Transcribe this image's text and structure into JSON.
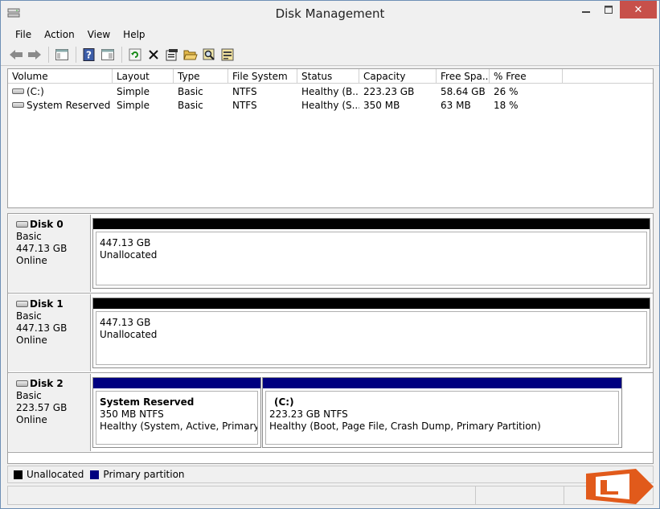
{
  "window": {
    "title": "Disk Management",
    "close_glyph": "✕",
    "minimize_glyph": "—",
    "maximize_glyph": "☐"
  },
  "menu": {
    "items": [
      {
        "label": "File"
      },
      {
        "label": "Action"
      },
      {
        "label": "View"
      },
      {
        "label": "Help"
      }
    ]
  },
  "toolbar": {
    "icons": [
      "back-arrow-icon",
      "forward-arrow-icon",
      "console-tree-icon",
      "help-icon",
      "properties-pane-icon",
      "refresh-icon",
      "delete-icon",
      "properties-icon",
      "open-icon",
      "search-icon",
      "disk-settings-icon"
    ]
  },
  "volume_list": {
    "columns": [
      "Volume",
      "Layout",
      "Type",
      "File System",
      "Status",
      "Capacity",
      "Free Spa...",
      "% Free"
    ],
    "rows": [
      {
        "volume": "(C:)",
        "layout": "Simple",
        "type": "Basic",
        "fs": "NTFS",
        "status": "Healthy (B...",
        "capacity": "223.23 GB",
        "free": "58.64 GB",
        "pct": "26 %"
      },
      {
        "volume": "System Reserved",
        "layout": "Simple",
        "type": "Basic",
        "fs": "NTFS",
        "status": "Healthy (S...",
        "capacity": "350 MB",
        "free": "63 MB",
        "pct": "18 %"
      }
    ]
  },
  "disks": [
    {
      "name": "Disk 0",
      "type": "Basic",
      "size": "447.13 GB",
      "state": "Online",
      "partitions": [
        {
          "title": "",
          "line1": "447.13 GB",
          "line2": "Unallocated",
          "kind": "unallocated"
        }
      ]
    },
    {
      "name": "Disk 1",
      "type": "Basic",
      "size": "447.13 GB",
      "state": "Online",
      "partitions": [
        {
          "title": "",
          "line1": "447.13 GB",
          "line2": "Unallocated",
          "kind": "unallocated"
        }
      ]
    },
    {
      "name": "Disk 2",
      "type": "Basic",
      "size": "223.57 GB",
      "state": "Online",
      "partitions": [
        {
          "title": "System Reserved",
          "line1": "350 MB NTFS",
          "line2": "Healthy (System, Active, Primary Part",
          "kind": "primary"
        },
        {
          "title": "(C:)",
          "line1": "223.23 GB NTFS",
          "line2": "Healthy (Boot, Page File, Crash Dump, Primary Partition)",
          "kind": "primary"
        }
      ]
    }
  ],
  "legend": [
    {
      "label": "Unallocated",
      "color": "#000000"
    },
    {
      "label": "Primary partition",
      "color": "#000080"
    }
  ],
  "colors": {
    "unallocated": "#000000",
    "primary": "#000080",
    "close_button": "#c7504a"
  }
}
